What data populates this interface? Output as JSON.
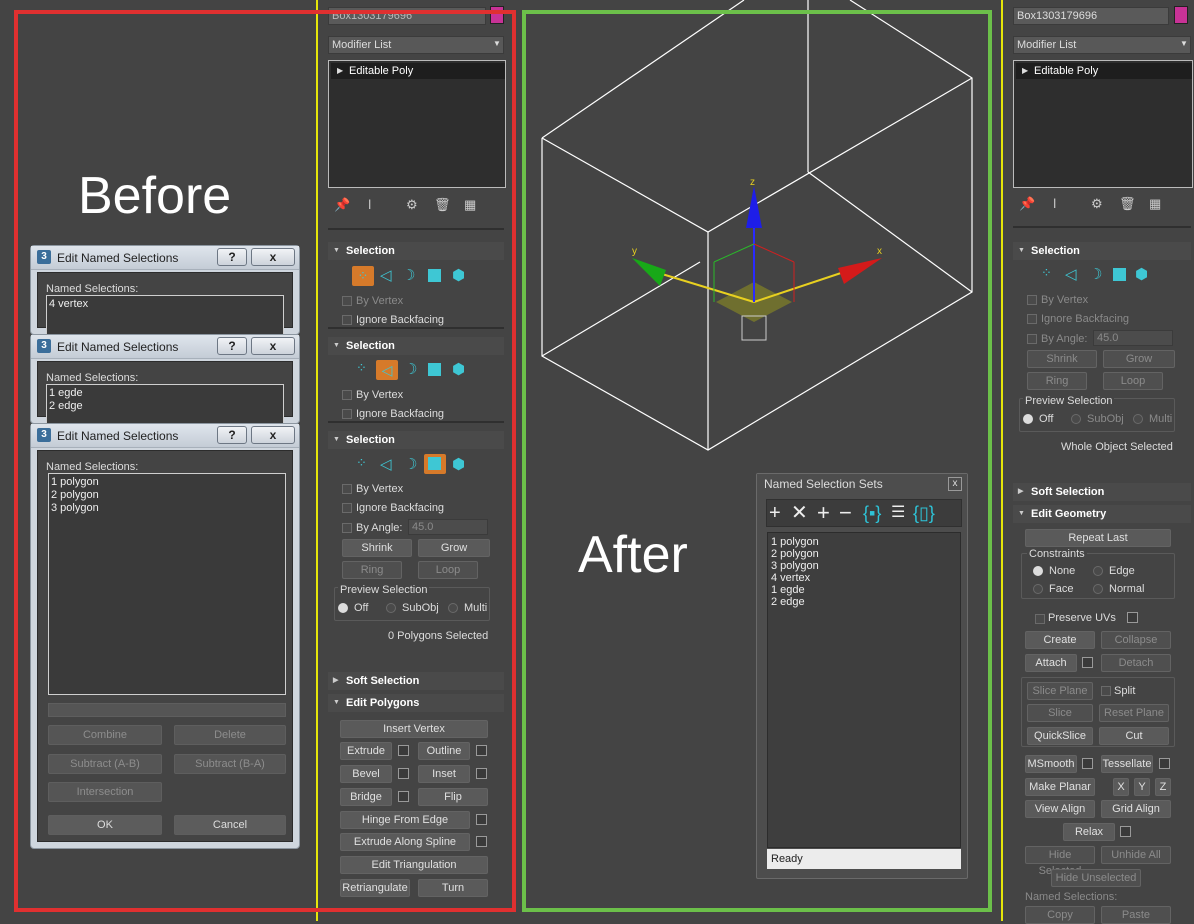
{
  "labels": {
    "before": "Before",
    "after": "After"
  },
  "colors": {
    "before_frame": "#e03030",
    "after_frame": "#6cc04a",
    "separator": "#e6e60a",
    "swatch": "#c83296"
  },
  "dialog_title": "Edit Named Selections",
  "dialog_help": "?",
  "dialog_close": "x",
  "named_label": "Named Selections:",
  "dlg1": {
    "items": [
      "4 vertex"
    ]
  },
  "dlg2": {
    "items": [
      "1 egde",
      "2 edge"
    ]
  },
  "dlg3": {
    "items": [
      "1 polygon",
      "2 polygon",
      "3 polygon"
    ],
    "buttons": {
      "combine": "Combine",
      "delete": "Delete",
      "subtract_ab": "Subtract (A-B)",
      "subtract_ba": "Subtract (B-A)",
      "intersection": "Intersection",
      "ok": "OK",
      "cancel": "Cancel"
    }
  },
  "left_panel": {
    "object_name": "Box1303179696",
    "modifier_list": "Modifier List",
    "stack_item": "Editable Poly",
    "selection_title": "Selection",
    "by_vertex": "By Vertex",
    "ignore_backfacing": "Ignore Backfacing",
    "by_angle": "By Angle:",
    "angle_value": "45.0",
    "shrink": "Shrink",
    "grow": "Grow",
    "ring": "Ring",
    "loop": "Loop",
    "preview_selection": "Preview Selection",
    "off": "Off",
    "subobj": "SubObj",
    "multi": "Multi",
    "selected_status": "0 Polygons Selected",
    "soft_selection": "Soft Selection",
    "edit_polygons": "Edit Polygons",
    "insert_vertex": "Insert Vertex",
    "extrude": "Extrude",
    "outline": "Outline",
    "bevel": "Bevel",
    "inset": "Inset",
    "bridge": "Bridge",
    "flip": "Flip",
    "hinge_from_edge": "Hinge From Edge",
    "extrude_along_spline": "Extrude Along Spline",
    "edit_triangulation": "Edit Triangulation",
    "retriangulate": "Retriangulate",
    "turn": "Turn"
  },
  "named_sets": {
    "title": "Named Selection Sets",
    "close": "x",
    "items": [
      "1 polygon",
      "2 polygon",
      "3 polygon",
      "4 vertex",
      "1 egde",
      "2 edge"
    ],
    "status": "Ready"
  },
  "right_panel": {
    "object_name": "Box1303179696",
    "modifier_list": "Modifier List",
    "stack_item": "Editable Poly",
    "selection_title": "Selection",
    "by_vertex": "By Vertex",
    "ignore_backfacing": "Ignore Backfacing",
    "by_angle": "By Angle:",
    "angle_value": "45.0",
    "shrink": "Shrink",
    "grow": "Grow",
    "ring": "Ring",
    "loop": "Loop",
    "preview_selection": "Preview Selection",
    "off": "Off",
    "subobj": "SubObj",
    "multi": "Multi",
    "whole_object": "Whole Object Selected",
    "soft_selection": "Soft Selection",
    "edit_geometry": "Edit Geometry",
    "repeat_last": "Repeat Last",
    "constraints": "Constraints",
    "none": "None",
    "edge": "Edge",
    "face": "Face",
    "normal": "Normal",
    "preserve_uvs": "Preserve UVs",
    "create": "Create",
    "collapse": "Collapse",
    "attach": "Attach",
    "detach": "Detach",
    "slice_plane": "Slice Plane",
    "split": "Split",
    "slice": "Slice",
    "reset_plane": "Reset Plane",
    "quickslice": "QuickSlice",
    "cut": "Cut",
    "msmooth": "MSmooth",
    "tessellate": "Tessellate",
    "make_planar": "Make Planar",
    "x": "X",
    "y": "Y",
    "z": "Z",
    "view_align": "View Align",
    "grid_align": "Grid Align",
    "relax": "Relax",
    "hide_selected": "Hide Selected",
    "unhide_all": "Unhide All",
    "hide_unselected": "Hide Unselected",
    "named_selections": "Named Selections:",
    "copy": "Copy",
    "paste": "Paste"
  },
  "viewport": {
    "axis_x": "x",
    "axis_y": "y",
    "axis_z": "z"
  }
}
